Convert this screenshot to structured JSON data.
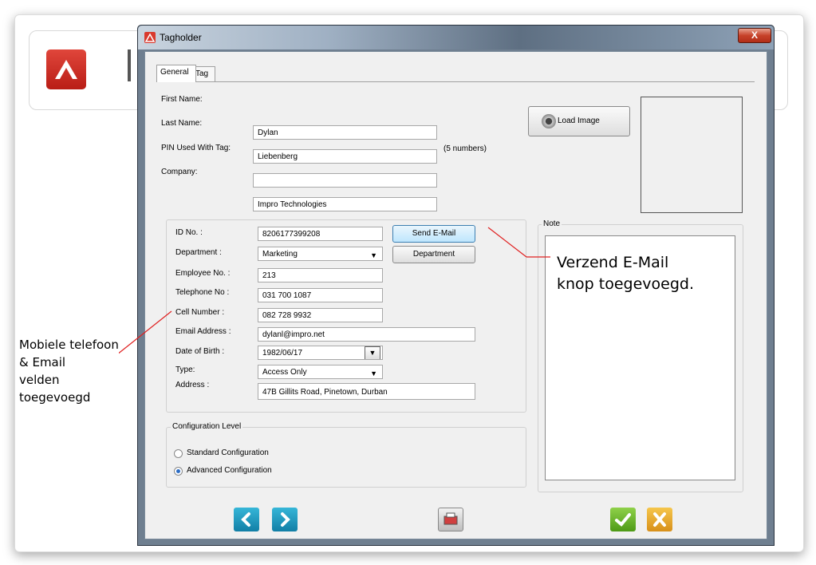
{
  "window": {
    "title": "Tagholder",
    "close_label": "X"
  },
  "tabs": [
    {
      "label": "General",
      "active": true
    },
    {
      "label": "Tag",
      "active": false
    }
  ],
  "personal": {
    "first_name_label": "First Name:",
    "first_name": "Dylan",
    "last_name_label": "Last Name:",
    "last_name": "Liebenberg",
    "pin_label": "PIN Used With Tag:",
    "pin": "",
    "pin_hint": "(5 numbers)",
    "company_label": "Company:",
    "company": "Impro Technologies"
  },
  "image": {
    "load_label": "Load Image"
  },
  "details": {
    "id_label": "ID No. :",
    "id": "8206177399208",
    "department_label": "Department :",
    "department": "Marketing",
    "employee_label": "Employee No. :",
    "employee": "213",
    "telephone_label": "Telephone No :",
    "telephone": "031 700 1087",
    "cell_label": "Cell Number :",
    "cell": "082 728 9932",
    "email_label": "Email Address :",
    "email": "dylanl@impro.net",
    "dob_label": "Date of Birth :",
    "dob": "1982/06/17",
    "type_label": "Type:",
    "type": "Access Only",
    "address_label": "Address :",
    "address": "47B Gillits Road, Pinetown, Durban",
    "send_email_label": "Send E-Mail",
    "department_button_label": "Department"
  },
  "note": {
    "label": "Note",
    "text": ""
  },
  "config": {
    "title": "Configuration Level",
    "options": [
      {
        "label": "Standard Configuration",
        "checked": false
      },
      {
        "label": "Advanced Configuration",
        "checked": true
      }
    ]
  },
  "annotations": {
    "left_lines": [
      "Mobiele telefoon",
      "& Email",
      "velden",
      "toegevoegd"
    ],
    "right_lines": [
      "Verzend E-Mail",
      "knop toegevoegd."
    ]
  },
  "colors": {
    "accent_red": "#d93a2e",
    "nav_teal": "#1a9bc0",
    "ok_green": "#5fae1f",
    "cancel_yellow": "#e8a317"
  }
}
